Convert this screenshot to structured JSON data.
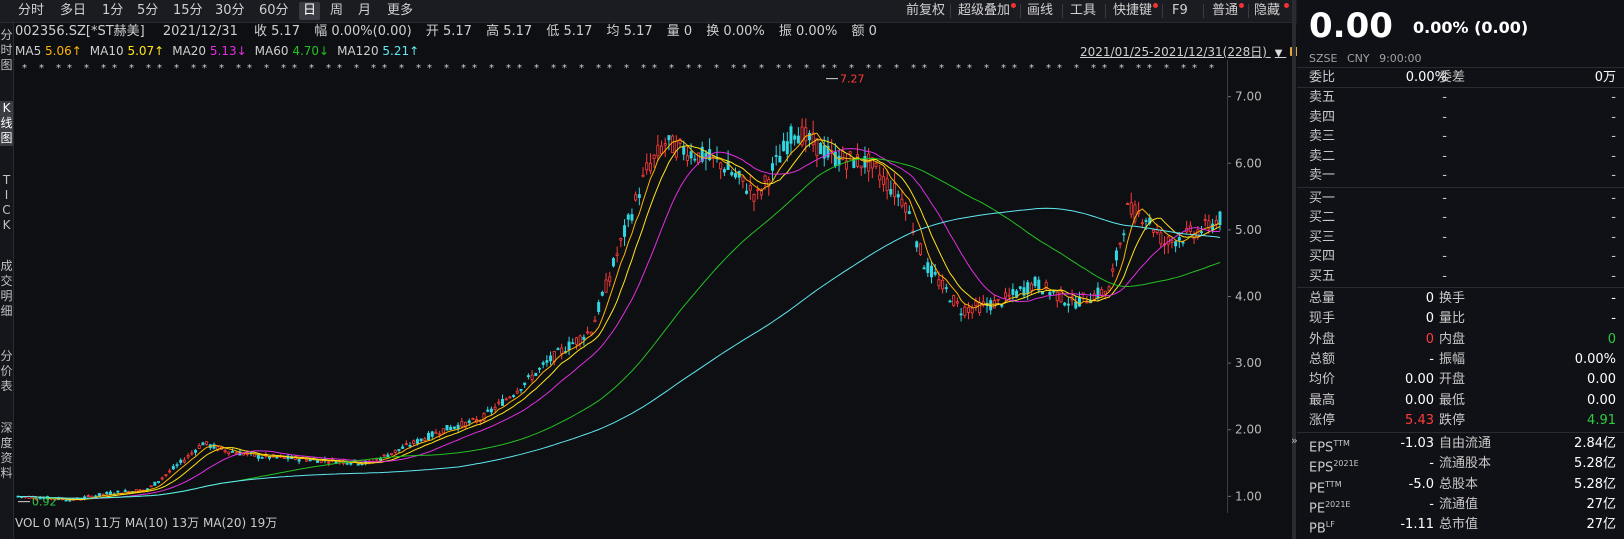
{
  "toolbar": {
    "periods": [
      "分时",
      "多日",
      "1分",
      "5分",
      "15分",
      "30分",
      "60分",
      "日",
      "周",
      "月",
      "更多"
    ],
    "active_period": "日",
    "right_items": [
      "前复权",
      "超级叠加",
      "画线",
      "工具",
      "快捷键",
      "F9",
      "普通",
      "隐藏"
    ]
  },
  "stock": {
    "header": "002356.SZ[*ST赫美]",
    "date": "2021/12/31",
    "close": "收 5.17",
    "change": "幅 0.00%(0.00)",
    "open": "开 5.17",
    "high": "高 5.17",
    "low": "低 5.17",
    "avg": "均 5.17",
    "volume": "量 0",
    "turnover": "换 0.00%",
    "amplitude": "振 0.00%",
    "amount": "额 0"
  },
  "ma_legend": [
    {
      "label": "MA5",
      "value": "5.06↑",
      "color": "#ffb400"
    },
    {
      "label": "MA10",
      "value": "5.07↑",
      "color": "#ffe41a"
    },
    {
      "label": "MA20",
      "value": "5.13↓",
      "color": "#e02fe0"
    },
    {
      "label": "MA60",
      "value": "4.70↓",
      "color": "#23c023"
    },
    {
      "label": "MA120",
      "value": "5.21↑",
      "color": "#5fe8f0"
    }
  ],
  "date_range": "2021/01/25-2021/12/31(228日)",
  "sidebar_tabs": [
    "分时图",
    "K线图",
    "TICK",
    "成交明细",
    "分价表",
    "深度资料"
  ],
  "active_sidebar": "K线图",
  "chart_data": {
    "type": "candlestick",
    "y_ticks": [
      "7.00",
      "6.00",
      "5.00",
      "4.00",
      "3.00",
      "2.00",
      "1.00"
    ],
    "ylim": [
      0.75,
      7.55
    ],
    "max_label": "7.27",
    "min_label": "0.92",
    "close_anchor_points": [
      [
        0,
        1.0
      ],
      [
        15,
        0.95
      ],
      [
        25,
        1.05
      ],
      [
        35,
        1.1
      ],
      [
        45,
        1.55
      ],
      [
        50,
        1.8
      ],
      [
        55,
        1.7
      ],
      [
        65,
        1.6
      ],
      [
        80,
        1.55
      ],
      [
        95,
        1.5
      ],
      [
        105,
        1.75
      ],
      [
        115,
        2.0
      ],
      [
        125,
        2.15
      ],
      [
        135,
        2.6
      ],
      [
        145,
        3.1
      ],
      [
        155,
        3.5
      ],
      [
        163,
        4.8
      ],
      [
        170,
        5.9
      ],
      [
        175,
        6.3
      ],
      [
        180,
        6.2
      ],
      [
        190,
        6.0
      ],
      [
        200,
        5.5
      ],
      [
        210,
        6.5
      ],
      [
        220,
        6.1
      ],
      [
        230,
        6.0
      ],
      [
        240,
        5.4
      ],
      [
        245,
        4.5
      ],
      [
        255,
        3.8
      ],
      [
        265,
        3.9
      ],
      [
        275,
        4.2
      ],
      [
        285,
        3.9
      ],
      [
        295,
        4.1
      ],
      [
        300,
        5.3
      ],
      [
        305,
        5.2
      ],
      [
        310,
        4.8
      ],
      [
        320,
        5.0
      ],
      [
        325,
        5.17
      ]
    ],
    "volume_legend": "VOL 0 MA(5) 11万 MA(10) 13万 MA(20) 19万"
  },
  "quote_panel": {
    "price": "0.00",
    "change": "0.00% (0.00)",
    "exchange": "SZSE",
    "currency": "CNY",
    "time": "9:00:00",
    "weibi_label": "委比",
    "weibi": "0.00%",
    "weicha_label": "委差",
    "weicha": "0万",
    "asks": [
      {
        "label": "卖五",
        "price": "-",
        "vol": "-"
      },
      {
        "label": "卖四",
        "price": "-",
        "vol": "-"
      },
      {
        "label": "卖三",
        "price": "-",
        "vol": "-"
      },
      {
        "label": "卖二",
        "price": "-",
        "vol": "-"
      },
      {
        "label": "卖一",
        "price": "-",
        "vol": "-"
      }
    ],
    "bids": [
      {
        "label": "买一",
        "price": "-",
        "vol": "-"
      },
      {
        "label": "买二",
        "price": "-",
        "vol": "-"
      },
      {
        "label": "买三",
        "price": "-",
        "vol": "-"
      },
      {
        "label": "买四",
        "price": "-",
        "vol": "-"
      },
      {
        "label": "买五",
        "price": "-",
        "vol": "-"
      }
    ],
    "stats": [
      {
        "l1": "总量",
        "v1": "0",
        "c1": "#ffffff",
        "l2": "换手",
        "v2": "-",
        "c2": "#ffffff"
      },
      {
        "l1": "现手",
        "v1": "0",
        "c1": "#ffffff",
        "l2": "量比",
        "v2": "-",
        "c2": "#ffffff"
      },
      {
        "l1": "外盘",
        "v1": "0",
        "c1": "#ff3b3b",
        "l2": "内盘",
        "v2": "0",
        "c2": "#2ecc40"
      },
      {
        "l1": "总额",
        "v1": "-",
        "c1": "#ffffff",
        "l2": "振幅",
        "v2": "0.00%",
        "c2": "#ffffff"
      },
      {
        "l1": "均价",
        "v1": "0.00",
        "c1": "#ffffff",
        "l2": "开盘",
        "v2": "0.00",
        "c2": "#ffffff"
      },
      {
        "l1": "最高",
        "v1": "0.00",
        "c1": "#ffffff",
        "l2": "最低",
        "v2": "0.00",
        "c2": "#ffffff"
      },
      {
        "l1": "涨停",
        "v1": "5.43",
        "c1": "#ff3b3b",
        "l2": "跌停",
        "v2": "4.91",
        "c2": "#2ecc40"
      }
    ],
    "fundamentals": [
      {
        "l1": "EPS",
        "sup1": "TTM",
        "v1": "-1.03",
        "l2": "自由流通",
        "v2": "2.84亿"
      },
      {
        "l1": "EPS",
        "sup1": "2021E",
        "v1": "-",
        "l2": "流通股本",
        "v2": "5.28亿"
      },
      {
        "l1": "PE",
        "sup1": "TTM",
        "v1": "-5.0",
        "l2": "总股本",
        "v2": "5.28亿"
      },
      {
        "l1": "PE",
        "sup1": "2021E",
        "v1": "-",
        "l2": "流通值",
        "v2": "27亿"
      },
      {
        "l1": "PB",
        "sup1": "LF",
        "v1": "-1.11",
        "l2": "总市值",
        "v2": "27亿"
      }
    ]
  }
}
